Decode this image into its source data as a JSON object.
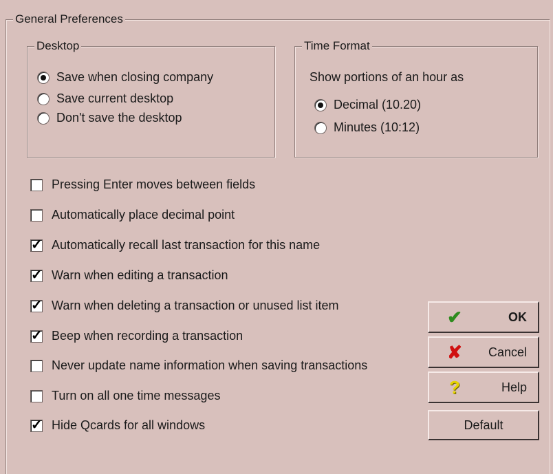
{
  "general": {
    "title": "General Preferences"
  },
  "desktop": {
    "title": "Desktop",
    "options": [
      {
        "label": "Save when closing company",
        "selected": true
      },
      {
        "label": "Save current desktop",
        "selected": false
      },
      {
        "label": "Don't save the desktop",
        "selected": false
      }
    ]
  },
  "time_format": {
    "title": "Time Format",
    "caption": "Show portions of an hour as",
    "options": [
      {
        "label": "Decimal (10.20)",
        "selected": true
      },
      {
        "label": "Minutes (10:12)",
        "selected": false
      }
    ]
  },
  "checkboxes": [
    {
      "label": "Pressing Enter moves between fields",
      "checked": false
    },
    {
      "label": "Automatically place decimal point",
      "checked": false
    },
    {
      "label": "Automatically recall last transaction for this name",
      "checked": true
    },
    {
      "label": "Warn when editing a transaction",
      "checked": true
    },
    {
      "label": "Warn when deleting a transaction or unused list item",
      "checked": true
    },
    {
      "label": "Beep when recording a transaction",
      "checked": true
    },
    {
      "label": "Never update name information when saving transactions",
      "checked": false
    },
    {
      "label": "Turn on all one time messages",
      "checked": false
    },
    {
      "label": "Hide Qcards for all windows",
      "checked": true
    }
  ],
  "buttons": {
    "ok": "OK",
    "cancel": "Cancel",
    "help": "Help",
    "default": "Default"
  },
  "icons": {
    "ok": "checkmark-icon",
    "cancel": "x-icon",
    "help": "question-icon"
  },
  "colors": {
    "background": "#d8c0bc",
    "ok_icon": "#2e8b1e",
    "cancel_icon": "#d01010",
    "help_icon": "#e6d400"
  }
}
